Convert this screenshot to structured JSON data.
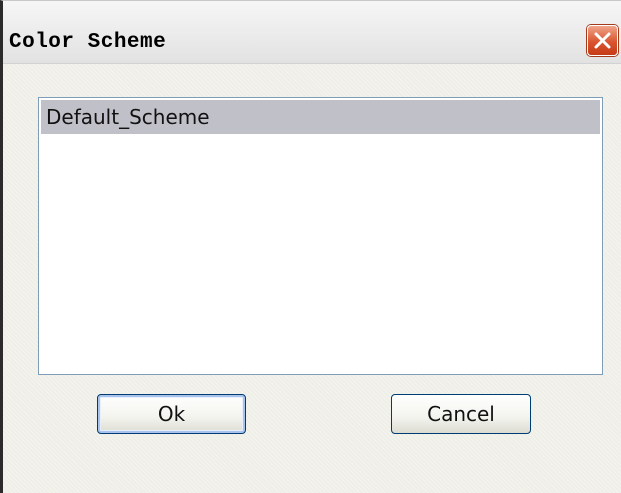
{
  "window": {
    "title": "Color Scheme",
    "close_icon": "close-icon"
  },
  "scheme_list": {
    "items": [
      "Default_Scheme"
    ],
    "selected": "Default_Scheme"
  },
  "buttons": {
    "ok_label": "Ok",
    "cancel_label": "Cancel"
  },
  "colors": {
    "close_button": "#d9552f",
    "selection": "#c0c0c8",
    "list_border": "#7f9db9",
    "button_border": "#003c74"
  }
}
